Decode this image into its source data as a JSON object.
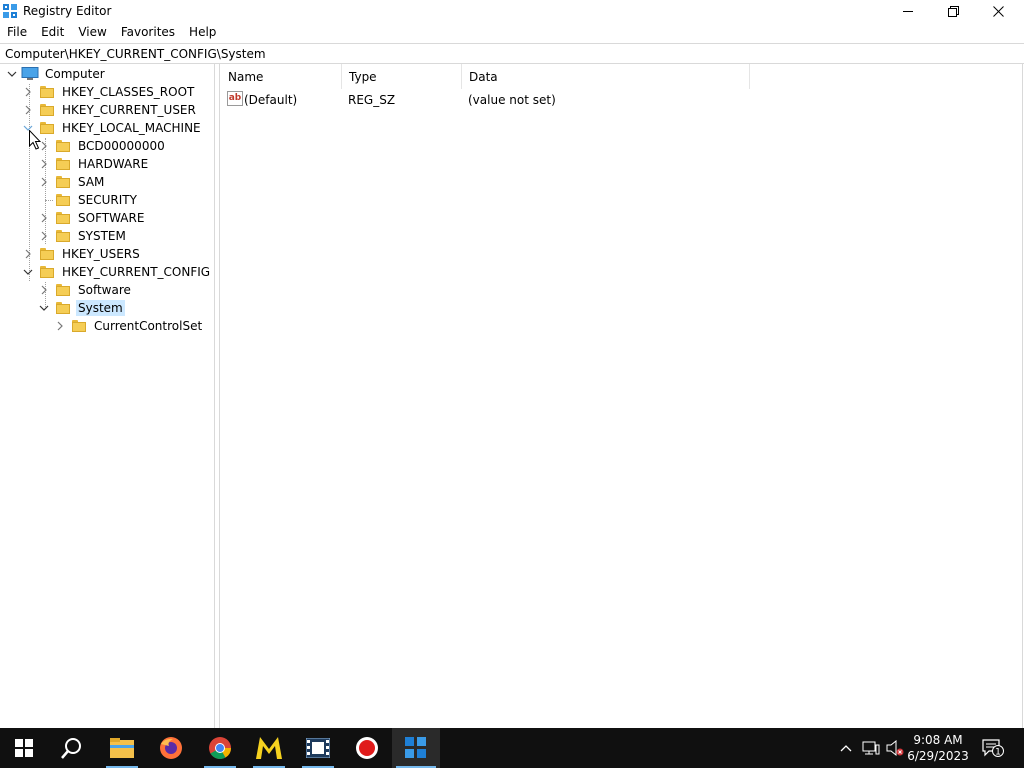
{
  "window": {
    "title": "Registry Editor",
    "controls": [
      "minimize",
      "maximize",
      "close"
    ]
  },
  "menu": {
    "items": [
      "File",
      "Edit",
      "View",
      "Favorites",
      "Help"
    ]
  },
  "address": {
    "value": "Computer\\HKEY_CURRENT_CONFIG\\System"
  },
  "tree": {
    "root": "Computer",
    "nodes": [
      {
        "label": "HKEY_CLASSES_ROOT",
        "level": 1,
        "expanded": false
      },
      {
        "label": "HKEY_CURRENT_USER",
        "level": 1,
        "expanded": false
      },
      {
        "label": "HKEY_LOCAL_MACHINE",
        "level": 1,
        "expanded": true
      },
      {
        "label": "BCD00000000",
        "level": 2,
        "expanded": false
      },
      {
        "label": "HARDWARE",
        "level": 2,
        "expanded": false
      },
      {
        "label": "SAM",
        "level": 2,
        "expanded": false
      },
      {
        "label": "SECURITY",
        "level": 2,
        "expanded": false
      },
      {
        "label": "SOFTWARE",
        "level": 2,
        "expanded": false
      },
      {
        "label": "SYSTEM",
        "level": 2,
        "expanded": false
      },
      {
        "label": "HKEY_USERS",
        "level": 1,
        "expanded": false
      },
      {
        "label": "HKEY_CURRENT_CONFIG",
        "level": 1,
        "expanded": true
      },
      {
        "label": "Software",
        "level": 2,
        "expanded": false
      },
      {
        "label": "System",
        "level": 2,
        "expanded": true,
        "selected": true
      },
      {
        "label": "CurrentControlSet",
        "level": 3,
        "expanded": false
      }
    ]
  },
  "list": {
    "columns": [
      "Name",
      "Type",
      "Data"
    ],
    "rows": [
      {
        "name": "(Default)",
        "type": "REG_SZ",
        "data": "(value not set)",
        "icon": "string-value-icon"
      }
    ]
  },
  "taskbar": {
    "icons": [
      "start-icon",
      "search-icon",
      "file-explorer-icon",
      "firefox-icon",
      "chrome-icon",
      "m-app-icon",
      "video-editor-icon",
      "record-icon",
      "registry-editor-icon"
    ],
    "time": "9:08 AM",
    "date": "6/29/2023",
    "notification_count": "1"
  },
  "colors": {
    "selection": "#cce8ff",
    "folder": "#f5cd55",
    "taskbar": "#101010",
    "accent": "#76b9ed"
  }
}
